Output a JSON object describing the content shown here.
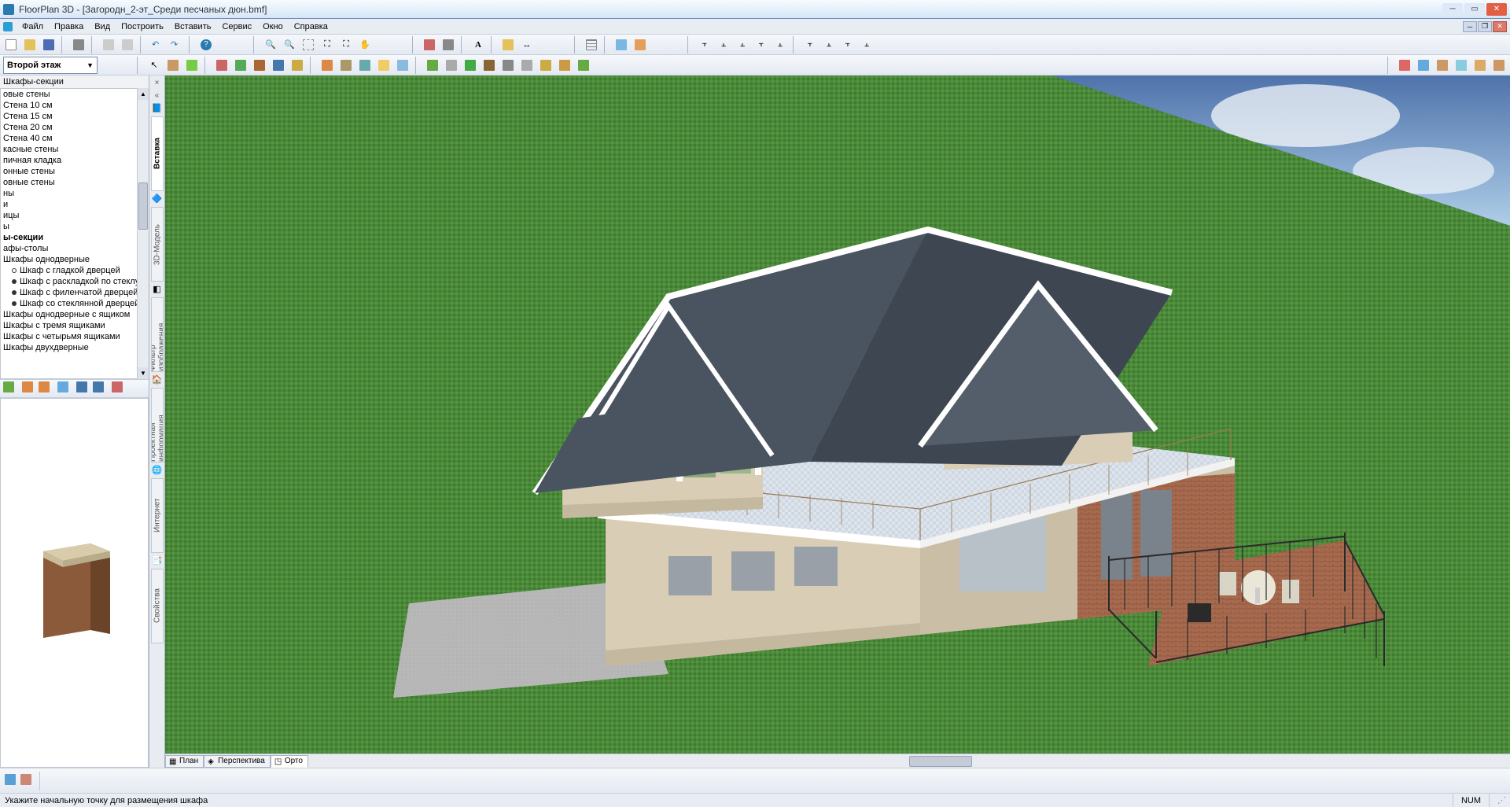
{
  "title": "FloorPlan 3D - [Загородн_2-эт_Среди песчаных дюн.bmf]",
  "menu": [
    "Файл",
    "Правка",
    "Вид",
    "Построить",
    "Вставить",
    "Сервис",
    "Окно",
    "Справка"
  ],
  "floor_select": "Второй этаж",
  "panel_title": "Шкафы-секции",
  "catalog": [
    {
      "t": "овые стены"
    },
    {
      "t": "Стена 10 см"
    },
    {
      "t": "Стена 15 см"
    },
    {
      "t": "Стена 20 см"
    },
    {
      "t": "Стена 40 см"
    },
    {
      "t": "касные стены"
    },
    {
      "t": "пичная кладка"
    },
    {
      "t": "онные стены"
    },
    {
      "t": "овные стены"
    },
    {
      "t": "ны"
    },
    {
      "t": "и"
    },
    {
      "t": "ицы"
    },
    {
      "t": "ы"
    },
    {
      "t": "ы-секции",
      "bold": true
    },
    {
      "t": "афы-столы"
    },
    {
      "t": "Шкафы однодверные"
    },
    {
      "t": "Шкаф с гладкой дверцей",
      "sub": "open"
    },
    {
      "t": "Шкаф с раскладкой по стеклу",
      "sub": "filled"
    },
    {
      "t": "Шкаф с филенчатой дверцей",
      "sub": "filled"
    },
    {
      "t": "Шкаф со стеклянной дверцей",
      "sub": "filled"
    },
    {
      "t": "Шкафы однодверные с ящиком"
    },
    {
      "t": "Шкафы с тремя ящиками"
    },
    {
      "t": "Шкафы с четырьмя ящиками"
    },
    {
      "t": "Шкафы двухдверные"
    }
  ],
  "vtabs": [
    "Вставка",
    "3D-Модель",
    "Фильтр изображения",
    "Проектная информация",
    "Интернет",
    "Свойства"
  ],
  "view_tabs": [
    {
      "label": "План",
      "active": false
    },
    {
      "label": "Перспектива",
      "active": false
    },
    {
      "label": "Орто",
      "active": true
    }
  ],
  "status_hint": "Укажите начальную точку для размещения шкафа",
  "status_right": "NUM",
  "colors": {
    "grass": "#4a8a3a",
    "grass2": "#3a6a2c",
    "sky": "#5b7fb8",
    "sky2": "#aecde8",
    "roof": "#4a5360",
    "wall": "#d9cdb6",
    "wall2": "#c4b89e",
    "trim": "#ffffff",
    "terrace": "#d5dde5",
    "brick": "#a76a4e",
    "rail": "#2a2a2a",
    "concrete": "#b4b4b4"
  }
}
